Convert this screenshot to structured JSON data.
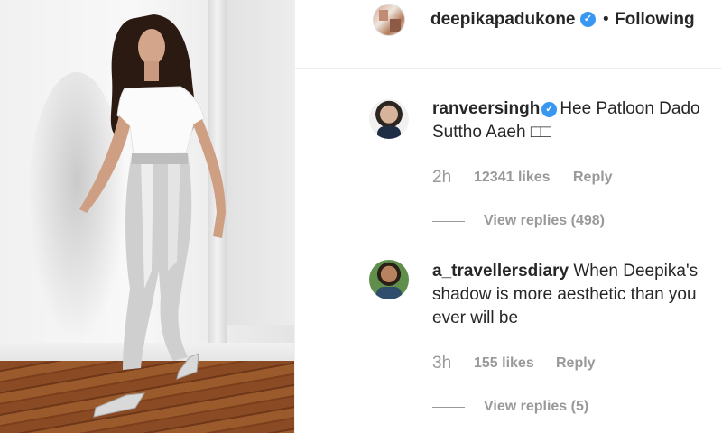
{
  "post": {
    "username": "deepikapadukone",
    "separator": "•",
    "follow_status": "Following",
    "verified_icon": "✓"
  },
  "comments": [
    {
      "username": "ranveersingh",
      "verified": true,
      "text": "Hee Patloon Dado Suttho Aaeh □□",
      "time": "2h",
      "likes": "12341 likes",
      "reply_label": "Reply",
      "view_replies": "View replies (498)"
    },
    {
      "username": "a_travellersdiary",
      "verified": false,
      "text": "When Deepika's shadow is more aesthetic than you ever will be",
      "time": "3h",
      "likes": "155 likes",
      "reply_label": "Reply",
      "view_replies": "View replies (5)"
    }
  ],
  "colors": {
    "text_primary": "#262626",
    "text_secondary": "#999999",
    "verified_blue": "#3897f0",
    "divider": "#efefef"
  }
}
